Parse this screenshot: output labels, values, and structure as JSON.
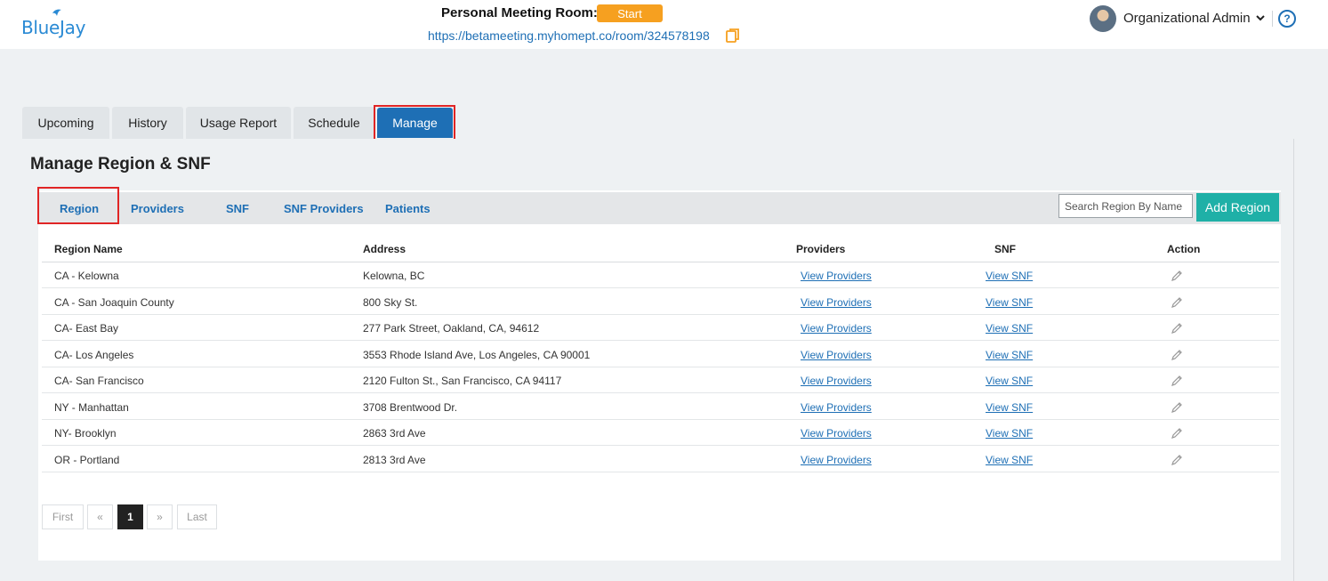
{
  "app": {
    "brand": "BlueJay"
  },
  "header": {
    "room_label": "Personal Meeting Room:",
    "start_label": "Start",
    "room_url": "https://betameeting.myhomept.co/room/324578198",
    "user_name": "Organizational Admin",
    "help_glyph": "?"
  },
  "main_tabs": [
    {
      "label": "Upcoming"
    },
    {
      "label": "History"
    },
    {
      "label": "Usage Report"
    },
    {
      "label": "Schedule"
    },
    {
      "label": "Manage",
      "active": true
    }
  ],
  "page": {
    "title": "Manage Region & SNF"
  },
  "sub_tabs": [
    {
      "label": "Region",
      "active": true
    },
    {
      "label": "Providers"
    },
    {
      "label": "SNF"
    },
    {
      "label": "SNF Providers"
    },
    {
      "label": "Patients"
    }
  ],
  "toolbar": {
    "search_placeholder": "Search Region By Name",
    "add_label": "Add Region"
  },
  "table": {
    "columns": [
      "Region Name",
      "Address",
      "Providers",
      "SNF",
      "Action"
    ],
    "rows": [
      {
        "region": "CA - Kelowna",
        "address": "Kelowna, BC",
        "providers": "View Providers",
        "snf": "View SNF"
      },
      {
        "region": "CA - San Joaquin County",
        "address": "800 Sky St.",
        "providers": "View Providers",
        "snf": "View SNF"
      },
      {
        "region": "CA- East Bay",
        "address": "277 Park Street, Oakland, CA, 94612",
        "providers": "View Providers",
        "snf": "View SNF"
      },
      {
        "region": "CA- Los Angeles",
        "address": "3553 Rhode Island Ave, Los Angeles, CA 90001",
        "providers": "View Providers",
        "snf": "View SNF"
      },
      {
        "region": "CA- San Francisco",
        "address": "2120 Fulton St., San Francisco, CA 94117",
        "providers": "View Providers",
        "snf": "View SNF"
      },
      {
        "region": "NY - Manhattan",
        "address": "3708 Brentwood Dr.",
        "providers": "View Providers",
        "snf": "View SNF"
      },
      {
        "region": "NY- Brooklyn",
        "address": "2863 3rd Ave",
        "providers": "View Providers",
        "snf": "View SNF"
      },
      {
        "region": "OR - Portland",
        "address": "2813 3rd Ave",
        "providers": "View Providers",
        "snf": "View SNF"
      }
    ]
  },
  "pagination": {
    "first": "First",
    "prev": "«",
    "current": "1",
    "next": "»",
    "last": "Last"
  },
  "colors": {
    "brand_blue": "#1e6fb5",
    "start_orange": "#f6a020",
    "add_teal": "#1fb0a7",
    "highlight_red": "#e02525"
  },
  "icons": [
    "bird-logo-icon",
    "copy-icon",
    "chevron-down-icon",
    "help-icon",
    "pencil-icon"
  ]
}
